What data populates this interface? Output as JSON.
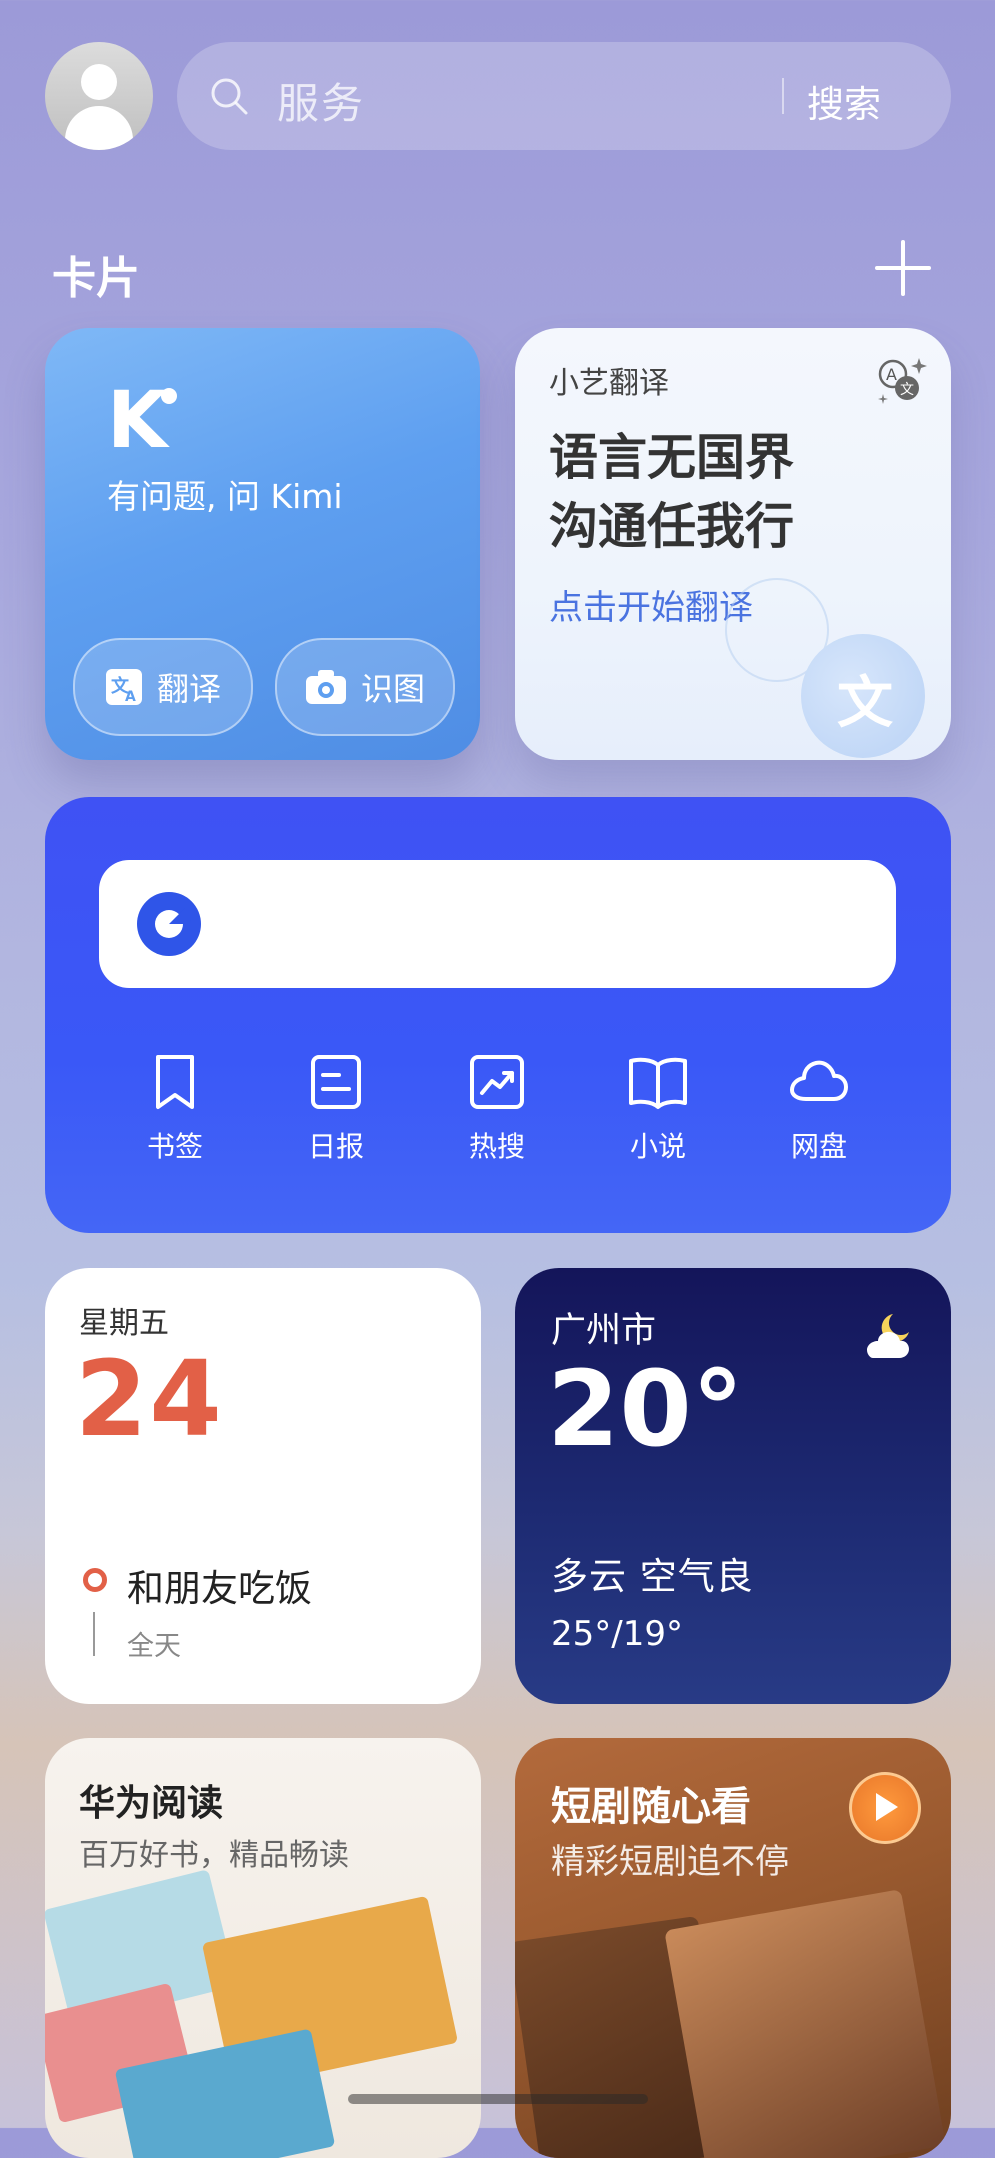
{
  "search": {
    "placeholder": "服务",
    "button": "搜索"
  },
  "section": {
    "title": "卡片"
  },
  "kimi_card": {
    "logo": "K",
    "prompt": "有问题, 问 Kimi",
    "buttons": [
      {
        "label": "翻译",
        "icon": "translate-icon"
      },
      {
        "label": "识图",
        "icon": "camera-icon"
      }
    ]
  },
  "translate_card": {
    "app_name": "小艺翻译",
    "headline_line1": "语言无国界",
    "headline_line2": "沟通任我行",
    "cta": "点击开始翻译",
    "deco_glyph": "文"
  },
  "browser_card": {
    "items": [
      {
        "label": "书签",
        "icon": "bookmark-icon"
      },
      {
        "label": "日报",
        "icon": "daily-report-icon"
      },
      {
        "label": "热搜",
        "icon": "trending-icon"
      },
      {
        "label": "小说",
        "icon": "book-icon"
      },
      {
        "label": "网盘",
        "icon": "cloud-icon"
      }
    ]
  },
  "calendar_card": {
    "weekday": "星期五",
    "day": "24",
    "event_title": "和朋友吃饭",
    "event_time": "全天",
    "accent": "#e26047"
  },
  "weather_card": {
    "city": "广州市",
    "temperature": "20°",
    "condition": "多云  空气良",
    "range": "25°/19°",
    "icon": "moon-cloud-icon"
  },
  "reading_card": {
    "title": "华为阅读",
    "subtitle": "百万好书，精品畅读"
  },
  "drama_card": {
    "title": "短剧随心看",
    "subtitle": "精彩短剧追不停"
  },
  "colors": {
    "browser_blue": "#3f52f4",
    "link_blue": "#4a73e0",
    "weather_navy": "#14155a"
  }
}
